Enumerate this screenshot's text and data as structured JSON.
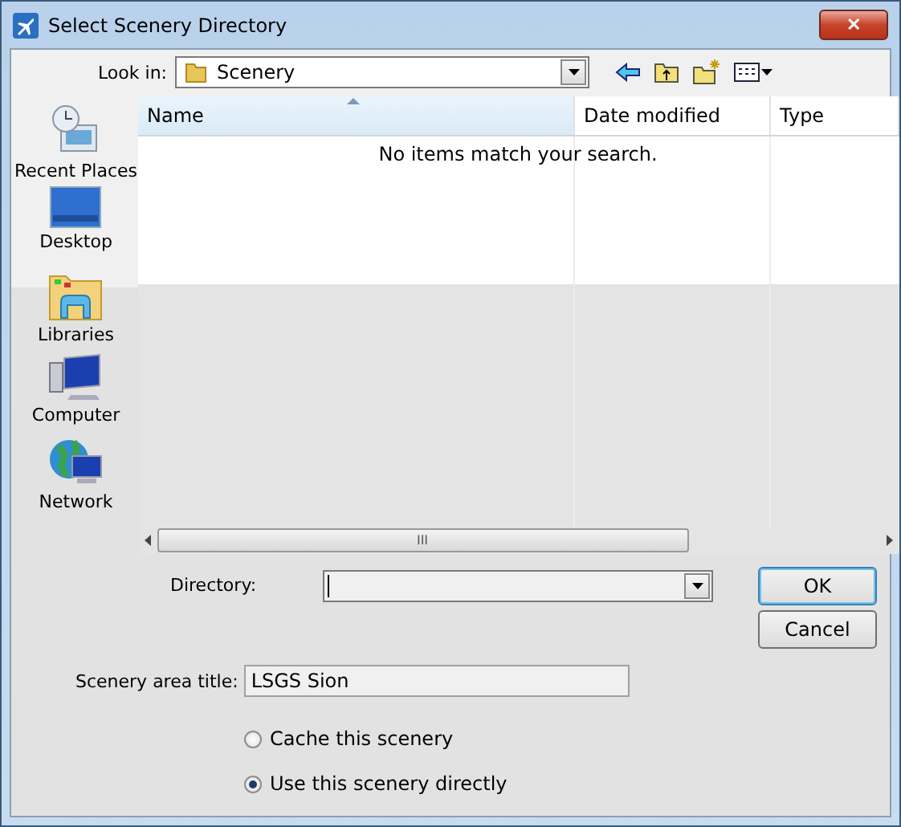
{
  "window": {
    "title": "Select Scenery Directory",
    "close_label": "✕"
  },
  "look_in": {
    "label": "Look in:",
    "value": "Scenery"
  },
  "places": [
    {
      "kind": "recent",
      "label": "Recent Places"
    },
    {
      "kind": "desktop",
      "label": "Desktop"
    },
    {
      "kind": "libraries",
      "label": "Libraries"
    },
    {
      "kind": "computer",
      "label": "Computer"
    },
    {
      "kind": "network",
      "label": "Network"
    }
  ],
  "file_list": {
    "columns": [
      {
        "label": "Name",
        "sorted": true
      },
      {
        "label": "Date modified",
        "sorted": false
      },
      {
        "label": "Type",
        "sorted": false
      }
    ],
    "empty_message": "No items match your search.",
    "scroll_thumb": "III"
  },
  "directory": {
    "label": "Directory:"
  },
  "buttons": [
    {
      "kind": "default",
      "label": "OK"
    },
    {
      "kind": "normal",
      "label": "Cancel"
    }
  ],
  "scenery_title": {
    "label": "Scenery area title:",
    "value": "LSGS Sion"
  },
  "options": [
    {
      "label": "Cache this scenery",
      "selected": false
    },
    {
      "label": "Use this scenery directly",
      "selected": true
    }
  ]
}
